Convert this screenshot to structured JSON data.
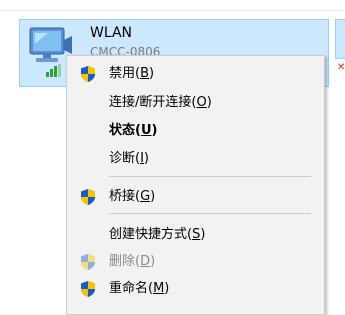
{
  "network": {
    "name": "WLAN",
    "ssid": "CMCC-0806",
    "icon": "wifi-adapter-icon"
  },
  "colors": {
    "tile_bg": "#cce8ff",
    "tile_border": "#99d1ff",
    "menu_bg": "#f2f2f2",
    "shield_blue": "#1f5bbf",
    "shield_yellow": "#f5c400",
    "disabled_text": "#8a8a8a"
  },
  "menu": {
    "items": [
      {
        "pre": "禁用(",
        "key": "B",
        "post": ")",
        "shield": true,
        "bold": false,
        "disabled": false
      },
      {
        "pre": "连接/断开连接(",
        "key": "O",
        "post": ")",
        "shield": false,
        "bold": false,
        "disabled": false
      },
      {
        "pre": "状态(",
        "key": "U",
        "post": ")",
        "shield": false,
        "bold": true,
        "disabled": false
      },
      {
        "pre": "诊断(",
        "key": "I",
        "post": ")",
        "shield": false,
        "bold": false,
        "disabled": false
      },
      {
        "pre": "桥接(",
        "key": "G",
        "post": ")",
        "shield": true,
        "bold": false,
        "disabled": false
      },
      {
        "pre": "创建快捷方式(",
        "key": "S",
        "post": ")",
        "shield": false,
        "bold": false,
        "disabled": false
      },
      {
        "pre": "删除(",
        "key": "D",
        "post": ")",
        "shield": true,
        "bold": false,
        "disabled": true
      },
      {
        "pre": "重命名(",
        "key": "M",
        "post": ")",
        "shield": true,
        "bold": false,
        "disabled": false
      }
    ]
  }
}
